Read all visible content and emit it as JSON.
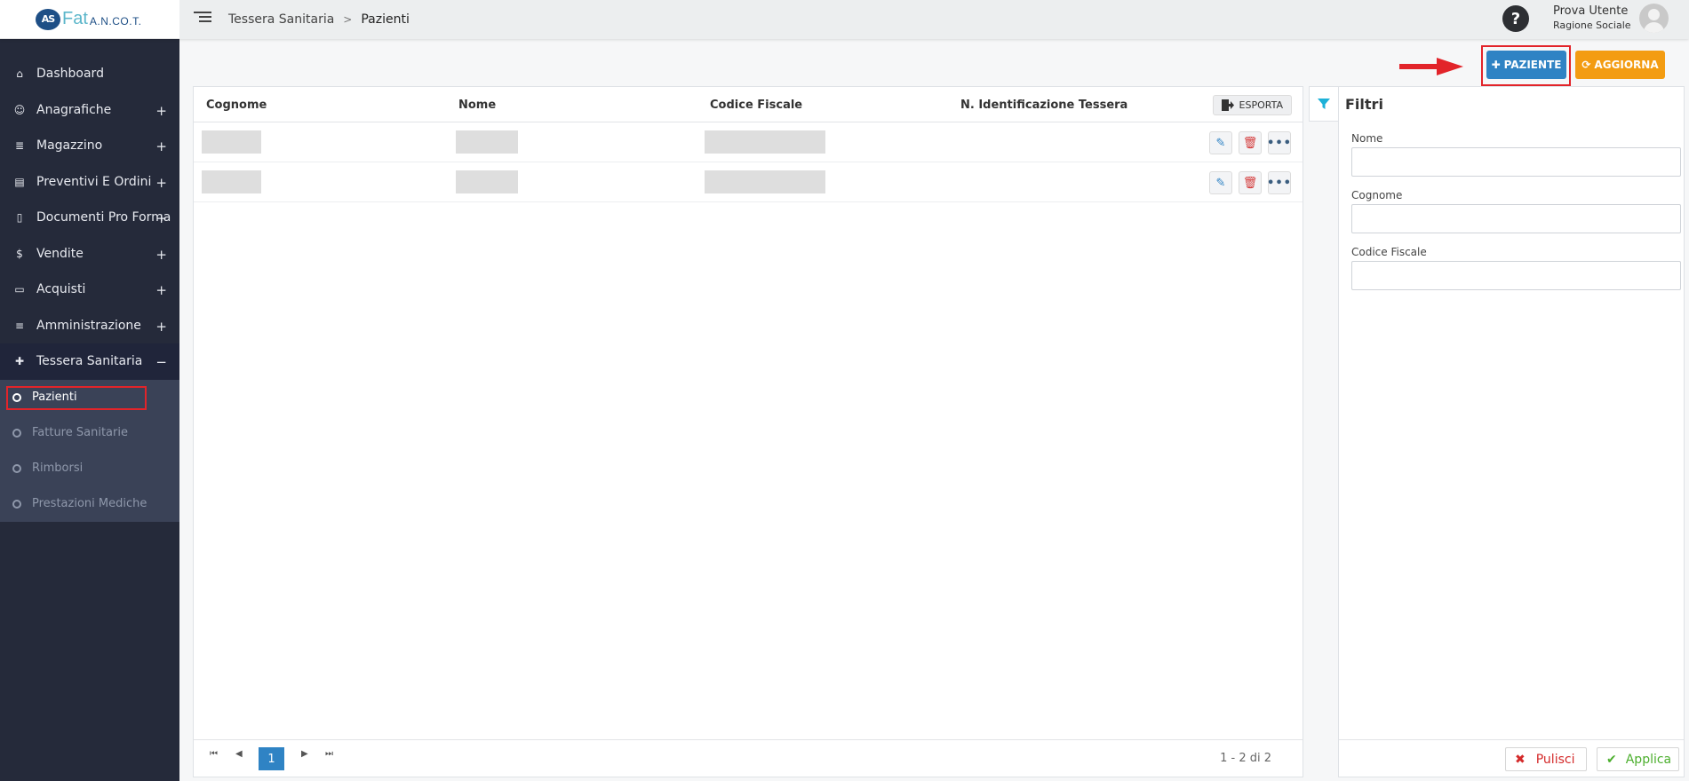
{
  "app": {
    "logo_mark": "AS",
    "logo_fat": "Fat",
    "logo_ancot": "A.N.CO.T."
  },
  "breadcrumb": {
    "parent": "Tessera Sanitaria",
    "separator": ">",
    "current": "Pazienti"
  },
  "user": {
    "help_glyph": "?",
    "name": "Prova Utente",
    "company": "Ragione Sociale"
  },
  "sidebar": {
    "items": [
      {
        "label": "Dashboard",
        "icon": "home-icon",
        "expand": ""
      },
      {
        "label": "Anagrafiche",
        "icon": "user-icon",
        "expand": "+"
      },
      {
        "label": "Magazzino",
        "icon": "boxes-icon",
        "expand": "+"
      },
      {
        "label": "Preventivi E Ordini",
        "icon": "clipboard-icon",
        "expand": "+"
      },
      {
        "label": "Documenti Pro Forma",
        "icon": "document-icon",
        "expand": "+"
      },
      {
        "label": "Vendite",
        "icon": "dollar-icon",
        "expand": "+"
      },
      {
        "label": "Acquisti",
        "icon": "credit-card-icon",
        "expand": "+"
      },
      {
        "label": "Amministrazione",
        "icon": "database-icon",
        "expand": "+"
      },
      {
        "label": "Tessera Sanitaria",
        "icon": "medical-kit-icon",
        "expand": "−"
      }
    ],
    "sub_items": [
      {
        "label": "Pazienti",
        "active": true
      },
      {
        "label": "Fatture Sanitarie",
        "active": false
      },
      {
        "label": "Rimborsi",
        "active": false
      },
      {
        "label": "Prestazioni Mediche",
        "active": false
      }
    ]
  },
  "actions": {
    "add_patient_label": "PAZIENTE",
    "refresh_label": "AGGIORNA",
    "add_glyph": "✚",
    "refresh_glyph": "⟳"
  },
  "table": {
    "columns": [
      "Cognome",
      "Nome",
      "Codice Fiscale",
      "N. Identificazione Tessera"
    ],
    "export_label": "ESPORTA",
    "rows": 2,
    "pagination": {
      "first": "⏮",
      "prev": "◀",
      "current_page": "1",
      "next": "▶",
      "last": "⏭",
      "info": "1 - 2 di 2"
    }
  },
  "filters": {
    "title": "Filtri",
    "fields": [
      {
        "label": "Nome",
        "value": "",
        "placeholder": ""
      },
      {
        "label": "Cognome",
        "value": "",
        "placeholder": ""
      },
      {
        "label": "Codice Fiscale",
        "value": "",
        "placeholder": ""
      }
    ],
    "clear_label": "Pulisci",
    "apply_label": "Applica"
  },
  "colors": {
    "sidebar_bg": "#252a3a",
    "primary_blue": "#2f83c4",
    "warning_orange": "#f39c12",
    "highlight_red": "#e2242a",
    "filter_cyan": "#1db1d8"
  }
}
